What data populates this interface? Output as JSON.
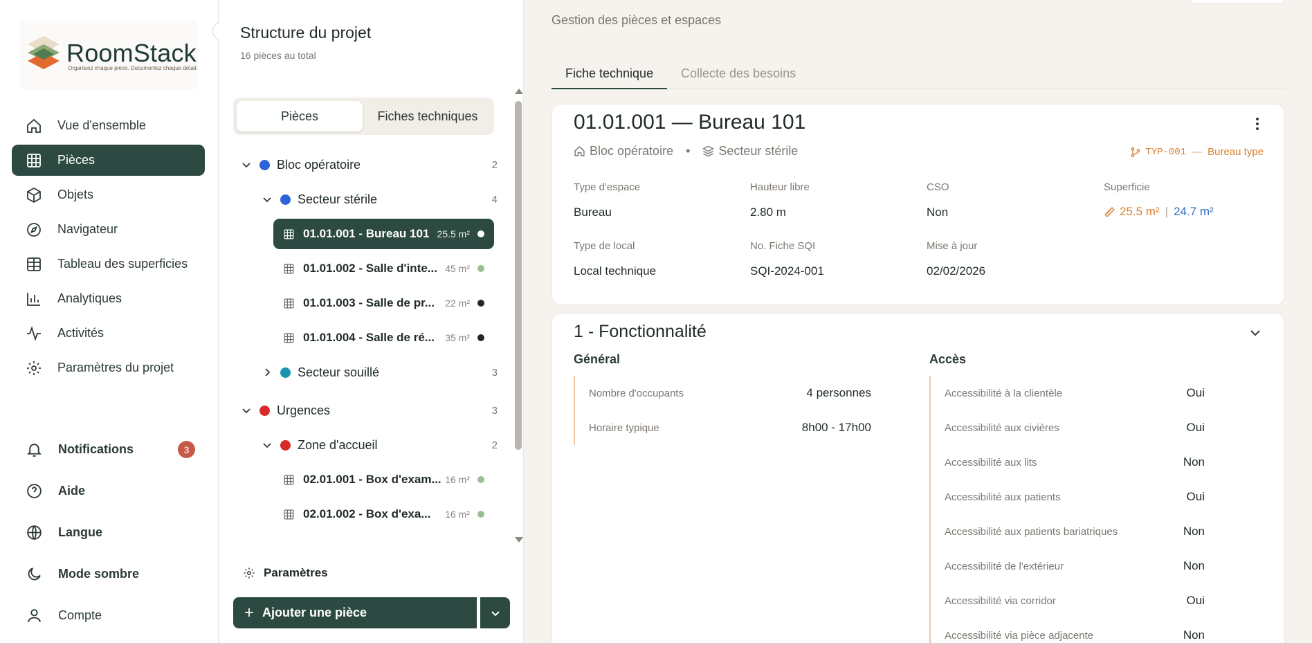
{
  "brand": {
    "name": "RoomStack",
    "tagline": "Organisez chaque pièce. Documentez chaque détail."
  },
  "nav": {
    "items": [
      {
        "label": "Vue d'ensemble",
        "icon": "home-icon"
      },
      {
        "label": "Pièces",
        "icon": "grid-icon",
        "active": true
      },
      {
        "label": "Objets",
        "icon": "cube-icon"
      },
      {
        "label": "Navigateur",
        "icon": "compass-icon"
      },
      {
        "label": "Tableau des superficies",
        "icon": "table-icon"
      },
      {
        "label": "Analytiques",
        "icon": "bar-chart-icon"
      },
      {
        "label": "Activités",
        "icon": "activity-icon"
      },
      {
        "label": "Paramètres du projet",
        "icon": "gear-icon"
      }
    ],
    "bottom": {
      "notifications": "Notifications",
      "notifications_count": "3",
      "help": "Aide",
      "language": "Langue",
      "dark_mode": "Mode sombre",
      "account": "Compte"
    }
  },
  "structure": {
    "title": "Structure du projet",
    "subtitle": "16 pièces au total",
    "segment": {
      "rooms": "Pièces",
      "sheets": "Fiches techniques"
    },
    "tree": {
      "bloc_op": {
        "label": "Bloc opératoire",
        "count": "2"
      },
      "secteur_sterile": {
        "label": "Secteur stérile",
        "count": "4"
      },
      "rooms_sterile": [
        {
          "label": "01.01.001 - Bureau 101",
          "area": "25.5 m²"
        },
        {
          "label": "01.01.002 - Salle d'inte...",
          "area": "45 m²"
        },
        {
          "label": "01.01.003 - Salle de pr...",
          "area": "22 m²"
        },
        {
          "label": "01.01.004 - Salle de ré...",
          "area": "35 m²"
        }
      ],
      "secteur_souille": {
        "label": "Secteur souillé",
        "count": "3"
      },
      "urgences": {
        "label": "Urgences",
        "count": "3"
      },
      "zone_accueil": {
        "label": "Zone d'accueil",
        "count": "2"
      },
      "rooms_accueil": [
        {
          "label": "02.01.001 - Box d'exam...",
          "area": "16 m²"
        },
        {
          "label": "02.01.002 - Box d'exa...",
          "area": "16 m²"
        }
      ]
    },
    "params": "Paramètres",
    "add_room": "Ajouter une pièce"
  },
  "main": {
    "subtitle": "Gestion des pièces et espaces",
    "tabs": [
      "Fiche technique",
      "Collecte des besoins"
    ],
    "room": {
      "title": "01.01.001 — Bureau 101",
      "bloc": "Bloc opératoire",
      "secteur": "Secteur stérile",
      "type_code": "TYP-001",
      "type_name": "Bureau type",
      "fields": {
        "type_espace_label": "Type d'espace",
        "type_espace": "Bureau",
        "hauteur_label": "Hauteur libre",
        "hauteur": "2.80 m",
        "cso_label": "CSO",
        "cso": "Non",
        "superficie_label": "Superficie",
        "superficie_a": "25.5 m²",
        "superficie_b": "24.7 m²",
        "type_local_label": "Type de local",
        "type_local": "Local technique",
        "fiche_label": "No. Fiche SQI",
        "fiche": "SQI-2024-001",
        "maj_label": "Mise à jour",
        "maj": "02/02/2026"
      }
    },
    "section": {
      "title": "1 - Fonctionnalité",
      "general_title": "Général",
      "general": [
        {
          "k": "Nombre d'occupants",
          "v": "4 personnes"
        },
        {
          "k": "Horaire typique",
          "v": "8h00 - 17h00"
        }
      ],
      "acces_title": "Accès",
      "acces": [
        {
          "k": "Accessibilité à la clientèle",
          "v": "Oui"
        },
        {
          "k": "Accessibilité aux civières",
          "v": "Oui"
        },
        {
          "k": "Accessibilité aux lits",
          "v": "Non"
        },
        {
          "k": "Accessibilité aux patients",
          "v": "Oui"
        },
        {
          "k": "Accessibilité aux patients bariatriques",
          "v": "Non"
        },
        {
          "k": "Accessibilité de l'extérieur",
          "v": "Non"
        },
        {
          "k": "Accessibilité via corridor",
          "v": "Oui"
        },
        {
          "k": "Accessibilité via pièce adjacente",
          "v": "Non"
        }
      ]
    }
  },
  "colors": {
    "primary": "#2d4a42",
    "accent_orange": "#d97f2a",
    "accent_blue": "#2f6fc5",
    "badge": "#c65a47"
  }
}
